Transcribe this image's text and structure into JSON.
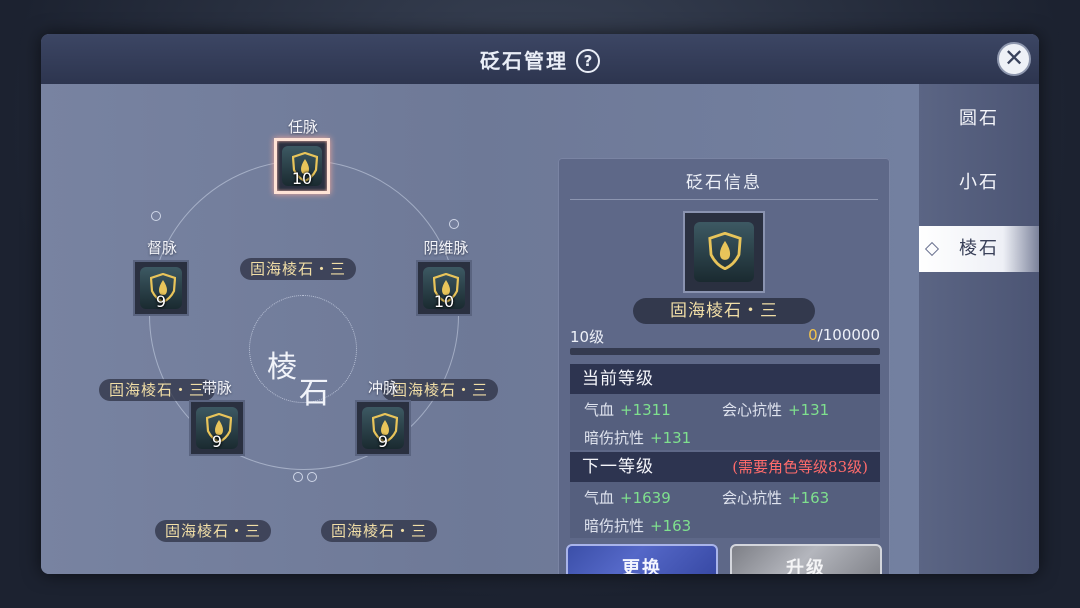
{
  "dialog": {
    "title": "砭石管理",
    "help_icon": "?",
    "close_icon": "✕"
  },
  "meridian_center": {
    "char1": "棱",
    "char2": "石"
  },
  "slots": [
    {
      "meridian": "任脉",
      "gem": "固海棱石・三",
      "level": "10",
      "selected": true
    },
    {
      "meridian": "督脉",
      "gem": "固海棱石・三",
      "level": "9",
      "selected": false
    },
    {
      "meridian": "阴维脉",
      "gem": "固海棱石・三",
      "level": "10",
      "selected": false
    },
    {
      "meridian": "带脉",
      "gem": "固海棱石・三",
      "level": "9",
      "selected": false
    },
    {
      "meridian": "冲脉",
      "gem": "固海棱石・三",
      "level": "9",
      "selected": false
    }
  ],
  "info": {
    "title": "砭石信息",
    "gem_name": "固海棱石・三",
    "level": "10级",
    "exp_current": "0",
    "exp_max": "/100000",
    "exp_fraction": 0,
    "current_header": "当前等级",
    "current_stats": {
      "hp_label": "气血",
      "hp_value": "+1311",
      "crit_res_label": "会心抗性",
      "crit_res_value": "+131",
      "dark_res_label": "暗伤抗性",
      "dark_res_value": "+131"
    },
    "next_header": "下一等级",
    "next_requirement": "(需要角色等级83级)",
    "next_stats": {
      "hp_label": "气血",
      "hp_value": "+1639",
      "crit_res_label": "会心抗性",
      "crit_res_value": "+163",
      "dark_res_label": "暗伤抗性",
      "dark_res_value": "+163"
    },
    "replace_button": "更换",
    "upgrade_button": "升级"
  },
  "tabs": [
    {
      "label": "圆石",
      "active": false
    },
    {
      "label": "小石",
      "active": false
    },
    {
      "label": "棱石",
      "active": true
    }
  ],
  "colors": {
    "gem_label": "#f1dea6",
    "stat_value": "#7fe08e",
    "requirement": "#ff6b6b",
    "exp_current": "#f3c34b"
  }
}
